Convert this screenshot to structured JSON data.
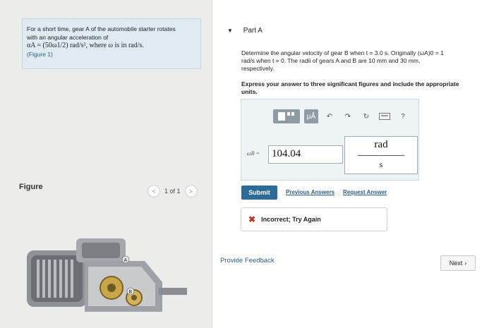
{
  "problem": {
    "line1": "For a short time, gear A of the automobile starter rotates",
    "line2": "with an angular acceleration of",
    "formula": "αA = (50ω1/2) rad/s², where ω is in rad/s.",
    "figure_link": "(Figure 1)"
  },
  "left": {
    "figure_label": "Figure",
    "pager_text": "1 of 1",
    "pager_prev": "<",
    "pager_next": ">"
  },
  "part": {
    "title": "Part A",
    "question_line1": "Determine the angular velocity of gear B when t = 3.0 s. Originally (ωA)0 = 1",
    "question_line2": "rad/s when t = 0. The radii of gears A and B are 10 mm and 30 mm,",
    "question_line3": "respectively.",
    "instruction": "Express your answer to three significant figures and include the appropriate units."
  },
  "toolbar": {
    "templates_icon": "templates-icon",
    "symbols_label": "μÅ",
    "undo_icon": "undo-icon",
    "redo_icon": "redo-icon",
    "reset_icon": "reset-icon",
    "keyboard_icon": "keyboard-icon",
    "help_label": "?"
  },
  "answer": {
    "variable": "ωB =",
    "value": "104.04",
    "unit_numerator": "rad",
    "unit_denominator": "s"
  },
  "actions": {
    "submit": "Submit",
    "previous_answers": "Previous Answers",
    "request_answer": "Request Answer"
  },
  "feedback": {
    "status": "Incorrect; Try Again"
  },
  "footer": {
    "provide_feedback": "Provide Feedback",
    "next": "Next"
  },
  "colors": {
    "accent": "#2c6b98",
    "error": "#c0392b",
    "problem_bg": "#dfeaf1"
  }
}
